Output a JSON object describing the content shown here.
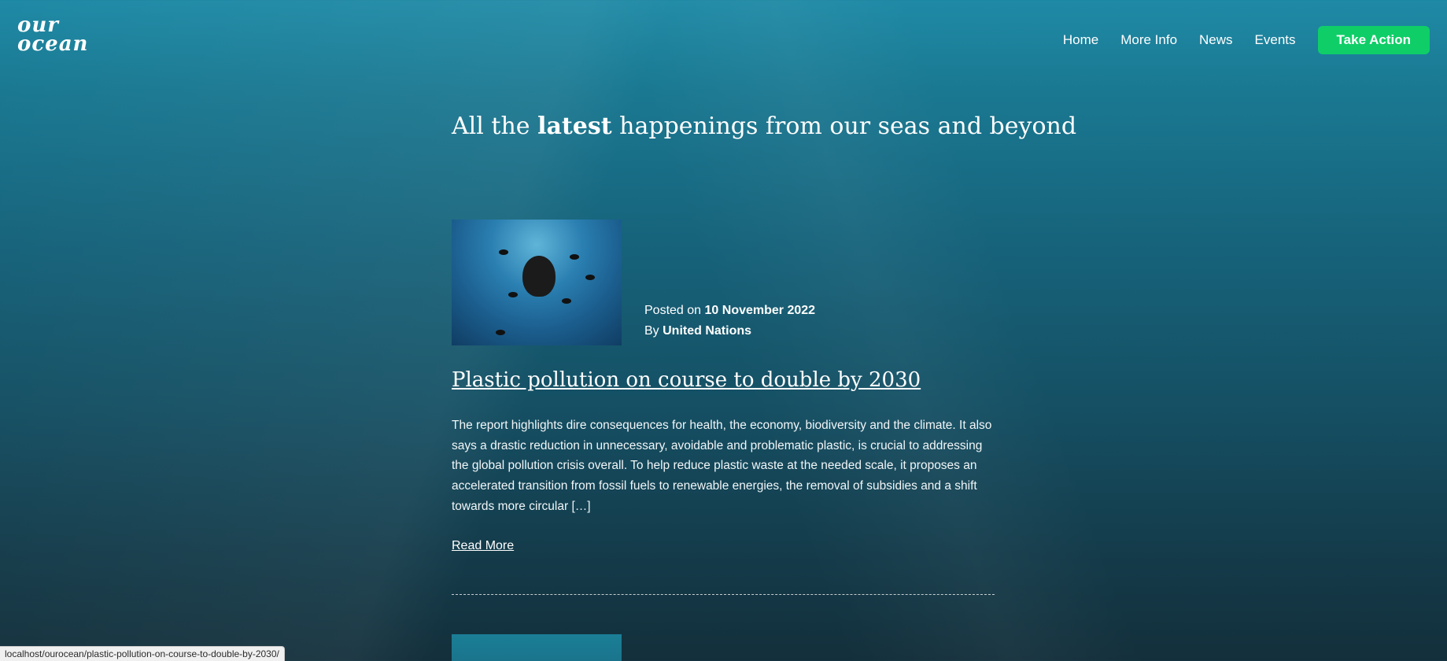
{
  "logo": {
    "line1": "our",
    "line2": "ocean"
  },
  "nav": {
    "items": [
      "Home",
      "More Info",
      "News",
      "Events"
    ],
    "cta": "Take Action"
  },
  "headline": {
    "pre": "All the",
    "bold": "latest",
    "post": "happenings from our seas and beyond"
  },
  "post": {
    "posted_prefix": "Posted on",
    "date": "10 November 2022",
    "by_prefix": "By",
    "author": "United Nations",
    "title": "Plastic pollution on course to double by 2030",
    "excerpt": "The report highlights dire consequences for health, the economy, biodiversity and the climate. It also says a drastic reduction in unnecessary, avoidable and problematic plastic, is crucial to addressing the global pollution crisis overall.   To help reduce plastic waste at the needed scale, it proposes an accelerated transition from fossil fuels to renewable energies, the removal of subsidies and a shift towards more circular […]",
    "read_more": "Read More"
  },
  "status_url": "localhost/ourocean/plastic-pollution-on-course-to-double-by-2030/",
  "colors": {
    "cta_bg": "#0fce67",
    "cta_text": "#174a5a",
    "bg_top": "#1f8aa6",
    "bg_bottom": "#132f3b"
  }
}
